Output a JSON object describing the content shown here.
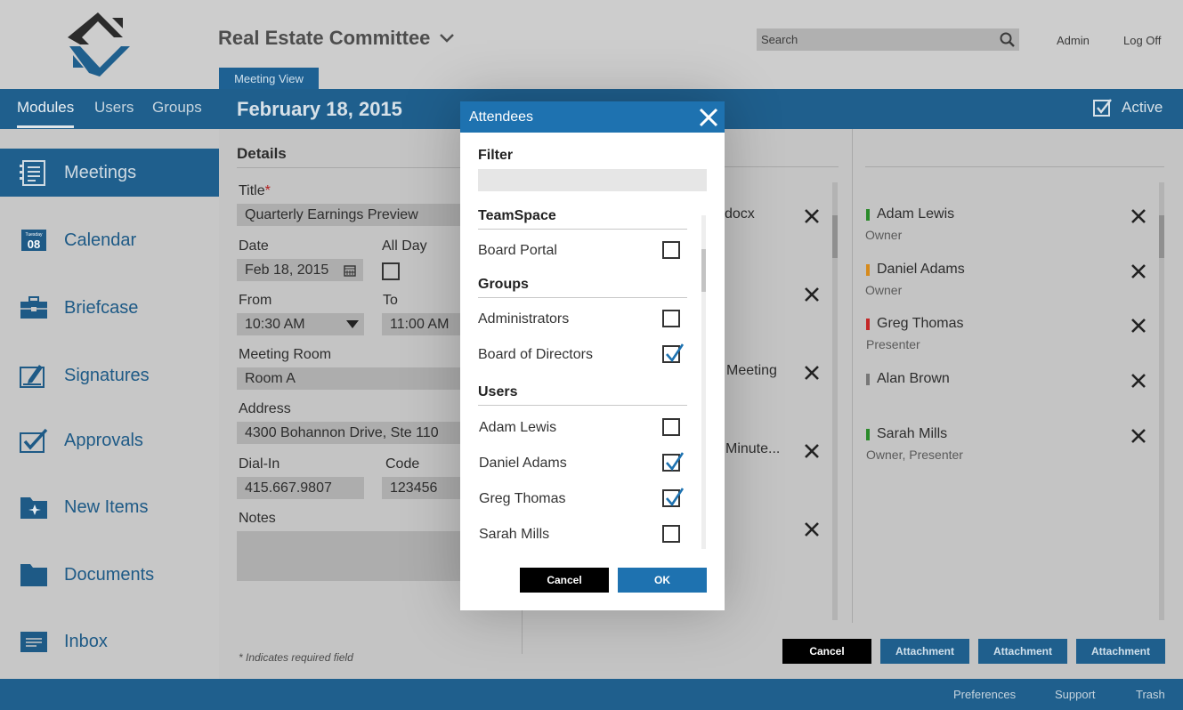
{
  "header": {
    "committee_title": "Real Estate Committee",
    "view_tab": "Meeting View",
    "search_placeholder": "Search",
    "admin_link": "Admin",
    "logoff_link": "Log Off"
  },
  "topnav": {
    "tabs": [
      "Modules",
      "Users",
      "Groups"
    ],
    "active_tab": "Modules",
    "page_date": "February 18, 2015",
    "active_label": "Active"
  },
  "sidebar": {
    "items": [
      {
        "label": "Meetings",
        "icon": "meetings-icon"
      },
      {
        "label": "Calendar",
        "icon": "calendar-icon",
        "icon_day": "Tuesday",
        "icon_date": "08"
      },
      {
        "label": "Briefcase",
        "icon": "briefcase-icon"
      },
      {
        "label": "Signatures",
        "icon": "signature-icon"
      },
      {
        "label": "Approvals",
        "icon": "approvals-icon"
      },
      {
        "label": "New Items",
        "icon": "new-items-icon"
      },
      {
        "label": "Documents",
        "icon": "folder-icon"
      },
      {
        "label": "Inbox",
        "icon": "inbox-icon"
      }
    ],
    "active": "Meetings"
  },
  "details": {
    "heading": "Details",
    "title_label": "Title",
    "required_mark": "*",
    "title_value": "Quarterly Earnings Preview",
    "date_label": "Date",
    "date_value": "Feb 18, 2015",
    "allday_label": "All Day",
    "from_label": "From",
    "from_value": "10:30 AM",
    "to_label": "To",
    "to_value": "11:00 AM",
    "room_label": "Meeting Room",
    "room_value": "Room A",
    "address_label": "Address",
    "address_value": "4300 Bohannon Drive, Ste 110",
    "dialin_label": "Dial-In",
    "dialin_value": "415.667.9807",
    "code_label": "Code",
    "code_value": "123456",
    "notes_label": "Notes",
    "required_note": "* Indicates required field"
  },
  "documents": {
    "visible_fragments": [
      "docx",
      "Meeting",
      "Minute..."
    ]
  },
  "attendees_panel": {
    "rows": [
      {
        "name": "Adam Lewis",
        "role": "Owner",
        "color": "#2a8a2a"
      },
      {
        "name": "Daniel Adams",
        "role": "Owner",
        "color": "#d68a1c"
      },
      {
        "name": "Greg Thomas",
        "role": "Presenter",
        "color": "#c42828"
      },
      {
        "name": "Alan Brown",
        "role": "",
        "color": "#777777"
      },
      {
        "name": "Sarah Mills",
        "role": "Owner, Presenter",
        "color": "#2a8a2a"
      }
    ]
  },
  "bottom_actions": {
    "cancel": "Cancel",
    "attachment_1": "Attachment",
    "attachment_2": "Attachment",
    "attachment_3": "Attachment"
  },
  "footer": {
    "links": [
      "Preferences",
      "Support",
      "Trash"
    ]
  },
  "modal": {
    "title": "Attendees",
    "filter_label": "Filter",
    "sections": {
      "teamspace": "TeamSpace",
      "groups": "Groups",
      "users": "Users"
    },
    "teamspace_items": [
      {
        "label": "Board Portal",
        "checked": false
      }
    ],
    "group_items": [
      {
        "label": "Administrators",
        "checked": false
      },
      {
        "label": "Board of Directors",
        "checked": true
      }
    ],
    "user_items": [
      {
        "label": "Adam Lewis",
        "checked": false
      },
      {
        "label": "Daniel Adams",
        "checked": true
      },
      {
        "label": "Greg Thomas",
        "checked": true
      },
      {
        "label": "Sarah Mills",
        "checked": false
      }
    ],
    "cancel": "Cancel",
    "ok": "OK"
  },
  "colors": {
    "brand_blue": "#1f5f8d",
    "modal_header": "#1e72b0",
    "check_blue": "#1e72b0"
  }
}
